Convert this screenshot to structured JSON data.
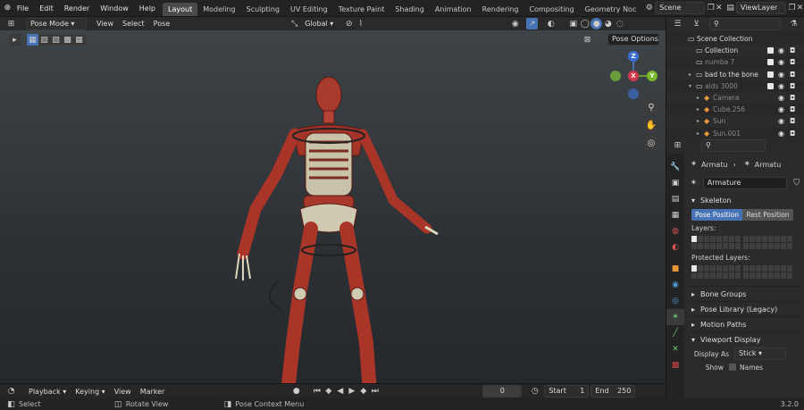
{
  "topbar": {
    "menus": [
      "File",
      "Edit",
      "Render",
      "Window",
      "Help"
    ],
    "workspaces": [
      "Layout",
      "Modeling",
      "Sculpting",
      "UV Editing",
      "Texture Paint",
      "Shading",
      "Animation",
      "Rendering",
      "Compositing",
      "Geometry Noc"
    ],
    "active_workspace": "Layout",
    "scene": "Scene",
    "view_layer": "ViewLayer"
  },
  "viewport_header": {
    "mode": "Pose Mode",
    "menus": [
      "View",
      "Select",
      "Pose"
    ],
    "orientation": "Global",
    "pose_options": "Pose Options"
  },
  "gizmo": {
    "z": "Z",
    "y": "Y",
    "x": "X"
  },
  "timeline": {
    "menus": [
      "Playback",
      "Keying",
      "View",
      "Marker"
    ],
    "current_frame": "0",
    "start_label": "Start",
    "start_value": "1",
    "end_label": "End",
    "end_value": "250"
  },
  "outliner": {
    "rows": [
      {
        "label": "Scene Collection",
        "indent": 0
      },
      {
        "label": "Collection",
        "indent": 1
      },
      {
        "label": "numba 7",
        "indent": 1
      },
      {
        "label": "bad to the bone",
        "indent": 1
      },
      {
        "label": "aids 3000",
        "indent": 1
      },
      {
        "label": "Camera",
        "indent": 2
      },
      {
        "label": "Cube.256",
        "indent": 2
      },
      {
        "label": "Sun",
        "indent": 2
      },
      {
        "label": "Sun.001",
        "indent": 2
      }
    ]
  },
  "properties": {
    "breadcrumb_a": "Armatu",
    "breadcrumb_b": "Armatu",
    "data_name": "Armature",
    "skeleton_label": "Skeleton",
    "pose_position": "Pose Position",
    "rest_position": "Rest Position",
    "layers_label": "Layers:",
    "protected_layers_label": "Protected Layers:",
    "bone_groups": "Bone Groups",
    "pose_library": "Pose Library (Legacy)",
    "motion_paths": "Motion Paths",
    "viewport_display": "Viewport Display",
    "display_as_label": "Display As",
    "display_as_value": "Stick",
    "show_label": "Show",
    "names_label": "Names"
  },
  "statusbar": {
    "select": "Select",
    "rotate_view": "Rotate View",
    "pose_context_menu": "Pose Context Menu",
    "version": "3.2.0"
  }
}
